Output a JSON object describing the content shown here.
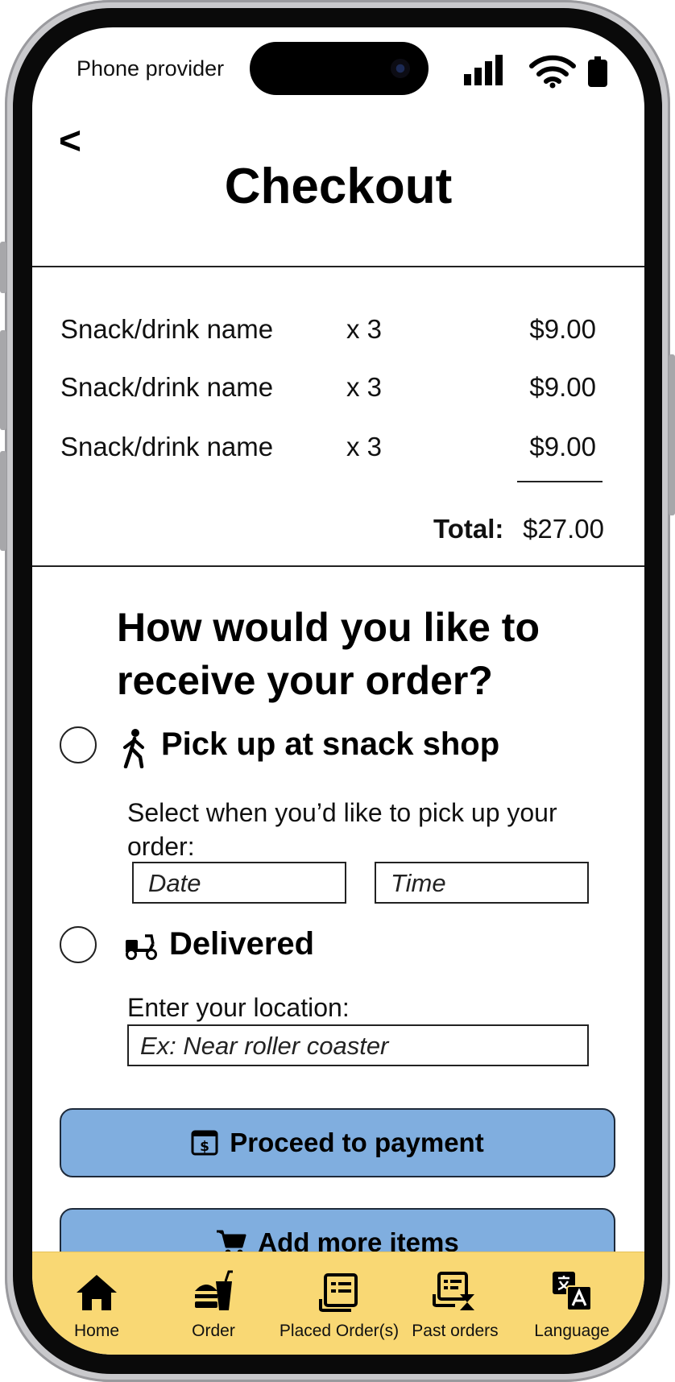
{
  "status_bar": {
    "carrier": "Phone provider"
  },
  "header": {
    "back_label": "<",
    "title": "Checkout"
  },
  "order": {
    "items": [
      {
        "name": "Snack/drink name",
        "qty": "x 3",
        "price": "$9.00"
      },
      {
        "name": "Snack/drink name",
        "qty": "x 3",
        "price": "$9.00"
      },
      {
        "name": "Snack/drink name",
        "qty": "x 3",
        "price": "$9.00"
      }
    ],
    "total_label": "Total:",
    "total_value": "$27.00"
  },
  "receive": {
    "question": "How would you like to receive your order?",
    "pickup": {
      "label": "Pick up at snack shop",
      "instruction": "Select when you’d like to pick up your order:",
      "date_placeholder": "Date",
      "time_placeholder": "Time"
    },
    "delivery": {
      "label": "Delivered",
      "instruction": "Enter your location:",
      "location_placeholder": "Ex:  Near roller coaster"
    }
  },
  "buttons": {
    "payment_label": "Proceed to payment",
    "add_items_label": "Add more items"
  },
  "colors": {
    "button_blue": "#80aedf",
    "nav_yellow": "#f9d874"
  },
  "bottom_nav": [
    {
      "label": "Home",
      "icon": "home-icon"
    },
    {
      "label": "Order",
      "icon": "fast-food-icon"
    },
    {
      "label": "Placed Order(s)",
      "icon": "receipt-icon"
    },
    {
      "label": "Past orders",
      "icon": "receipt-history-icon"
    },
    {
      "label": "Language",
      "icon": "translate-icon"
    }
  ]
}
